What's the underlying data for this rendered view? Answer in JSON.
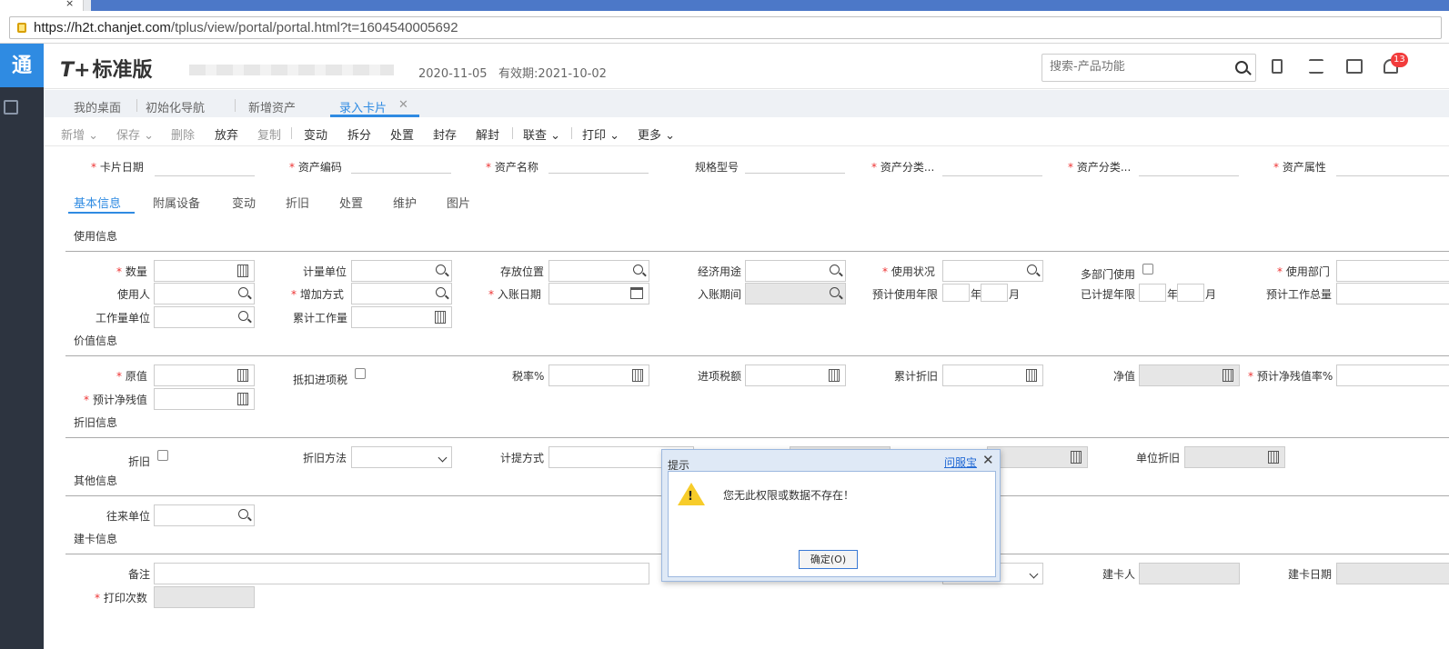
{
  "browser": {
    "tab_close": "×",
    "url_host": "https://h2t.chanjet.com",
    "url_path": "/tplus/view/portal/portal.html?t=1604540005692"
  },
  "rail": {
    "logo": "通"
  },
  "header": {
    "brand_mark": "T+",
    "brand_name": "标准版",
    "login_date": "2020-11-05",
    "validity": "有效期:2021-10-02",
    "search_placeholder": "搜索-产品功能",
    "notification_count": "13"
  },
  "page_tabs": [
    {
      "label": "我的桌面"
    },
    {
      "label": "初始化导航"
    },
    {
      "label": "新增资产"
    },
    {
      "label": "录入卡片",
      "close": "✕"
    }
  ],
  "toolbar": {
    "new": "新增",
    "save": "保存",
    "delete": "删除",
    "abandon": "放弃",
    "copy": "复制",
    "change": "变动",
    "split": "拆分",
    "dispose": "处置",
    "seal": "封存",
    "unseal": "解封",
    "link": "联查",
    "print": "打印",
    "more": "更多"
  },
  "header_fields": {
    "card_date": "卡片日期",
    "asset_code": "资产编码",
    "asset_name": "资产名称",
    "spec_model": "规格型号",
    "asset_category1": "资产分类...",
    "asset_category2": "资产分类...",
    "asset_attr": "资产属性"
  },
  "inner_tabs": {
    "basic": "基本信息",
    "attached": "附属设备",
    "change": "变动",
    "depr": "折旧",
    "dispose": "处置",
    "maintain": "维护",
    "picture": "图片"
  },
  "sections": {
    "usage": "使用信息",
    "value": "价值信息",
    "depreciation": "折旧信息",
    "other": "其他信息",
    "card": "建卡信息"
  },
  "usage": {
    "qty": "数量",
    "unit": "计量单位",
    "location": "存放位置",
    "economic_use": "经济用途",
    "use_status": "使用状况",
    "multi_dept": "多部门使用",
    "use_dept": "使用部门",
    "user": "使用人",
    "add_method": "增加方式",
    "entry_date": "入账日期",
    "entry_period": "入账期间",
    "est_life": "预计使用年限",
    "year": "年",
    "month": "月",
    "depr_years": "已计提年限",
    "est_work": "预计工作总量",
    "work_unit": "工作量单位",
    "cum_work": "累计工作量"
  },
  "value": {
    "orig": "原值",
    "deduct_tax": "抵扣进项税",
    "tax_rate": "税率%",
    "input_tax": "进项税额",
    "cum_depr": "累计折旧",
    "net": "净值",
    "residual_rate": "预计净残值率%",
    "residual": "预计净残值"
  },
  "depr": {
    "depr": "折旧",
    "method": "折旧方法",
    "calc_way": "计提方式",
    "unit_depr": "单位折旧"
  },
  "other": {
    "partner": "往来单位"
  },
  "card": {
    "remark": "备注",
    "creator": "建卡人",
    "create_date": "建卡日期",
    "print_count": "打印次数"
  },
  "dialog": {
    "title": "提示",
    "help_link": "问服宝",
    "close": "✕",
    "warn_mark": "!",
    "message": "您无此权限或数据不存在！",
    "ok": "确定(O)"
  }
}
